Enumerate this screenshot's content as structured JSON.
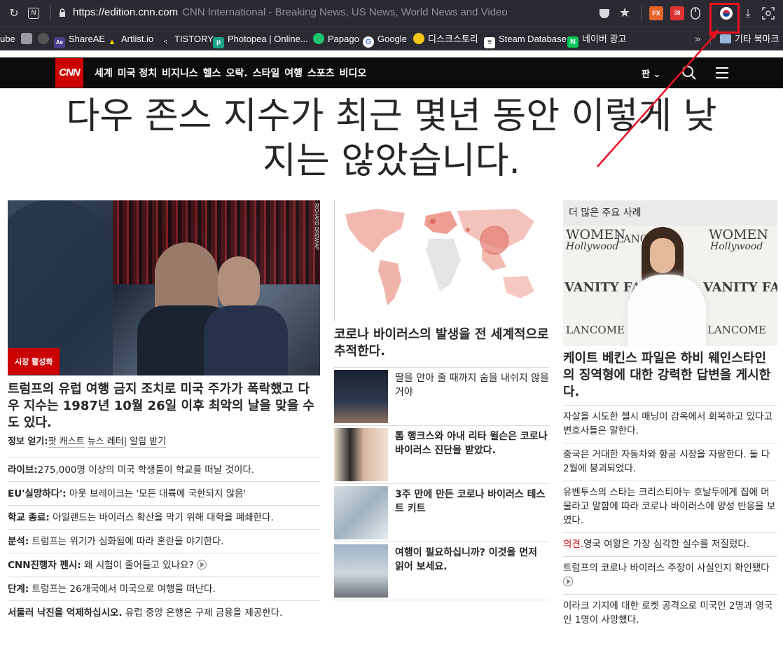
{
  "browser": {
    "url_host": "https://edition.cnn.com",
    "page_title": "CNN International - Breaking News, US News, World News and Video",
    "bookmarks": [
      "ube",
      "ShareAE",
      "Artlist.io",
      "TISTORY",
      "Photopea | Online...",
      "Papago",
      "Google",
      "디스크스토리",
      "Steam Database",
      "네이버 광고",
      "기타 북마크"
    ],
    "overflow": "»"
  },
  "cnn": {
    "logo": "CNN",
    "nav": [
      "세계",
      "미국 정치",
      "비지니스",
      "헬스",
      "오락.",
      "스타일",
      "여행",
      "스포츠",
      "비디오"
    ],
    "edition": "판"
  },
  "headline": {
    "line1": "다우 존스 지수가 최근 몇년 동안 이렇게 낮",
    "line2": "지는 않았습니다."
  },
  "col1": {
    "photo_credit": "RICHARD DREW/AP",
    "badge": "시장 활성화",
    "lead": "트럼프의 유럽 여행 금지 조치로 미국 주가가 폭락했고 다우 지수는 1987년 10월 26일 이후 최악의 날을 맞을 수도 있다.",
    "getinfo_label": "정보 얻기:",
    "getinfo_links": [
      "팟 캐스트",
      "뉴스 레터",
      "알림 받기"
    ],
    "items": [
      {
        "label": "라이브:",
        "text": "275,000명 이상의 미국 학생들이 학교를 떠날 것이다."
      },
      {
        "label": "EU'실망하다':",
        "text": " 아웃 브레이크는 '모든 대륙에 국한되지 않음'"
      },
      {
        "label": "학교 종료:",
        "text": " 아일랜드는 바이러스 확산을 막기 위해 대학을 폐쇄한다."
      },
      {
        "label": "분석:",
        "text": " 트럼프는 위기가 심화됨에 따라 혼란을 야기한다."
      },
      {
        "label": "CNN진행자 펜시:",
        "text": " 왜 시험이 줄어들고 있나요?"
      },
      {
        "label": "단계:",
        "text": " 트럼프는 26개국에서 미국으로 여행을 떠난다."
      },
      {
        "label": "서둘러 낙진을 억제하십시오.",
        "text": " 유럽 중앙 은행은 구제 금융을 제공한다."
      }
    ]
  },
  "col2": {
    "map_title": "코로나 바이러스의 발생을 전 세계적으로 추적한다.",
    "stories": [
      {
        "text": "딸을 안아 줄 때까지 숨을 내쉬지 않을 거야",
        "bold": false
      },
      {
        "text": "톰 행크스와 아내 리타 윌슨은 코로나 바이러스 진단을 받았다.",
        "bold": true
      },
      {
        "text": "3주 만에 만든 코로나 바이러스 테스트 키트",
        "bold": true
      },
      {
        "text": "여행이 필요하십니까? 이것을 먼저 읽어 보세요.",
        "bold": true
      }
    ]
  },
  "col3": {
    "header": "더 많은 주요 사례",
    "photo_wall": [
      "WOMEN",
      "Hollywood",
      "LANCOME",
      "VANITY FAIR"
    ],
    "lead": "케이트 베킨스 파일은 하비 웨인스타인의 징역형에 대한 강력한 답변을 게시한다.",
    "items": [
      {
        "prefix": "",
        "text": "자살을 시도한 첼시 매닝이 감옥에서 회복하고 있다고 변호사들은 말한다."
      },
      {
        "prefix": "",
        "text": "중국은 거대한 자동차와 항공 시장을 자랑한다. 둘 다 2월에 붕괴되었다."
      },
      {
        "prefix": "",
        "text": "유벤투스의 스타는 크리스티아누 호날두에게 집에 머물라고 말함에 따라 코로나 바이러스에 양성 반응을 보였다."
      },
      {
        "prefix": "의견.",
        "text": "영국 여왕은 가장 심각한 실수를 저질렀다."
      },
      {
        "prefix": "",
        "text": "트럼프의 코로나 바이러스 주장이 사실인지 확인됐다"
      },
      {
        "prefix": "",
        "text": "이라크 기지에 대한 로켓 공격으로 미국인 2명과 영국인 1명이 사망했다."
      }
    ]
  },
  "colors": {
    "cnn_red": "#cc0000",
    "annotation_red": "#e81123",
    "chrome_bg": "#2b2a33"
  }
}
